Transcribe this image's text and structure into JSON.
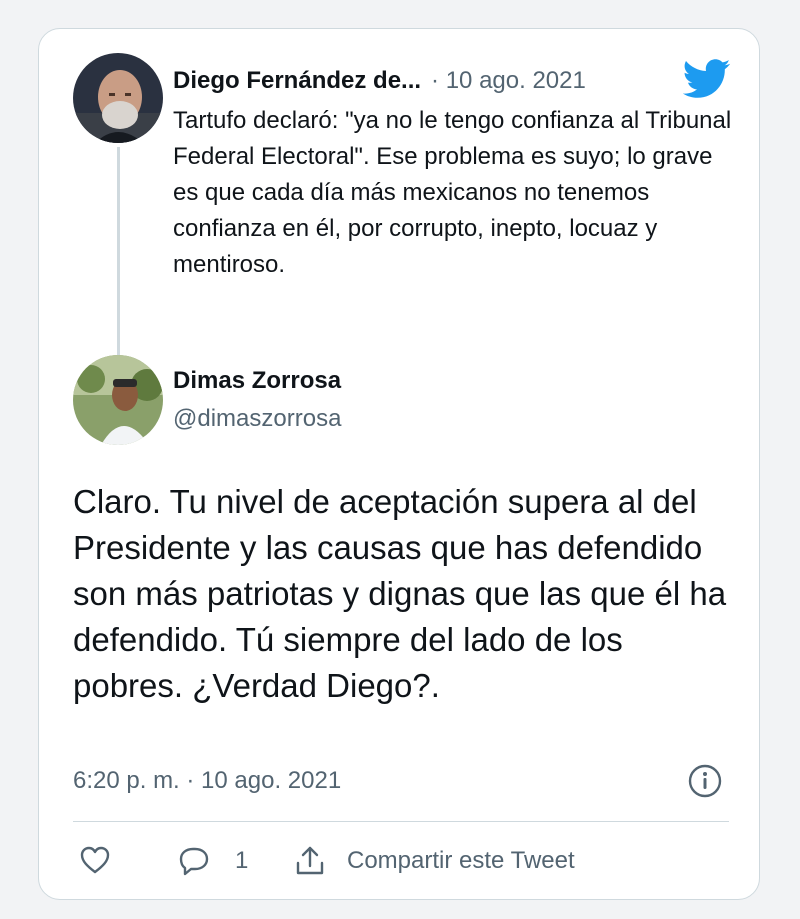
{
  "quoted_tweet": {
    "author_name": "Diego Fernández de...",
    "date": "· 10 ago. 2021",
    "text": "Tartufo declaró: \"ya no le tengo confianza al Tribunal Federal Electoral\". Ese problema es suyo; lo grave es que cada día más mexicanos no tenemos confianza en él, por corrupto, inepto, locuaz y mentiroso."
  },
  "reply_tweet": {
    "author_name": "Dimas Zorrosa",
    "handle": "@dimaszorrosa",
    "text": "Claro. Tu nivel de aceptación supera al del Presidente y las causas que has defendido son más patriotas y dignas que las que él ha defendido. Tú siempre del lado de los pobres. ¿Verdad Diego?.",
    "timestamp": "6:20 p. m. · 10 ago. 2021"
  },
  "actions": {
    "reply_count": "1",
    "share_label": "Compartir este Tweet"
  },
  "icons": {
    "brand": "twitter-bird-icon",
    "info": "info-icon",
    "like": "heart-icon",
    "reply": "reply-bubble-icon",
    "share": "share-icon"
  },
  "colors": {
    "twitter_blue": "#1d9bf0",
    "text_primary": "#0f1419",
    "text_secondary": "#536471",
    "border": "#cfd9de"
  }
}
